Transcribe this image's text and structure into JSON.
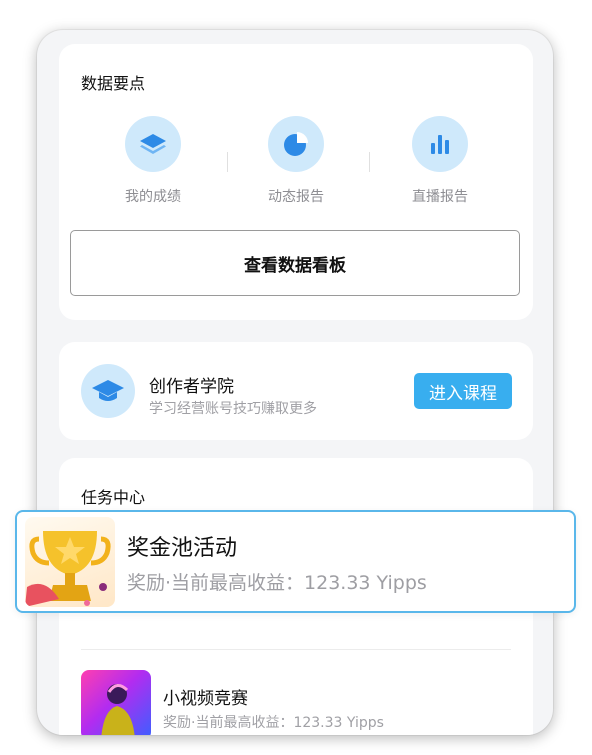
{
  "data_section": {
    "title": "数据要点",
    "items": [
      {
        "label": "我的成绩",
        "icon": "layers-icon"
      },
      {
        "label": "动态报告",
        "icon": "pie-chart-icon"
      },
      {
        "label": "直播报告",
        "icon": "bar-chart-icon"
      }
    ],
    "dashboard_button": "查看数据看板"
  },
  "academy": {
    "title": "创作者学院",
    "subtitle": "学习经营账号技巧赚取更多",
    "button": "进入课程",
    "icon": "graduation-cap-icon"
  },
  "tasks": {
    "title": "任务中心",
    "items": [
      {
        "title": "奖金池活动",
        "subtitle": "奖励·当前最高收益：123.33 Yipps",
        "icon": "trophy-image"
      },
      {
        "title": "小视频竞赛",
        "subtitle": "奖励·当前最高收益：123.33 Yipps",
        "icon": "video-thumbnail"
      }
    ]
  },
  "colors": {
    "accent": "#38aeef",
    "icon_bg": "#cfe9fb",
    "highlight_border": "#5ab7ea"
  }
}
